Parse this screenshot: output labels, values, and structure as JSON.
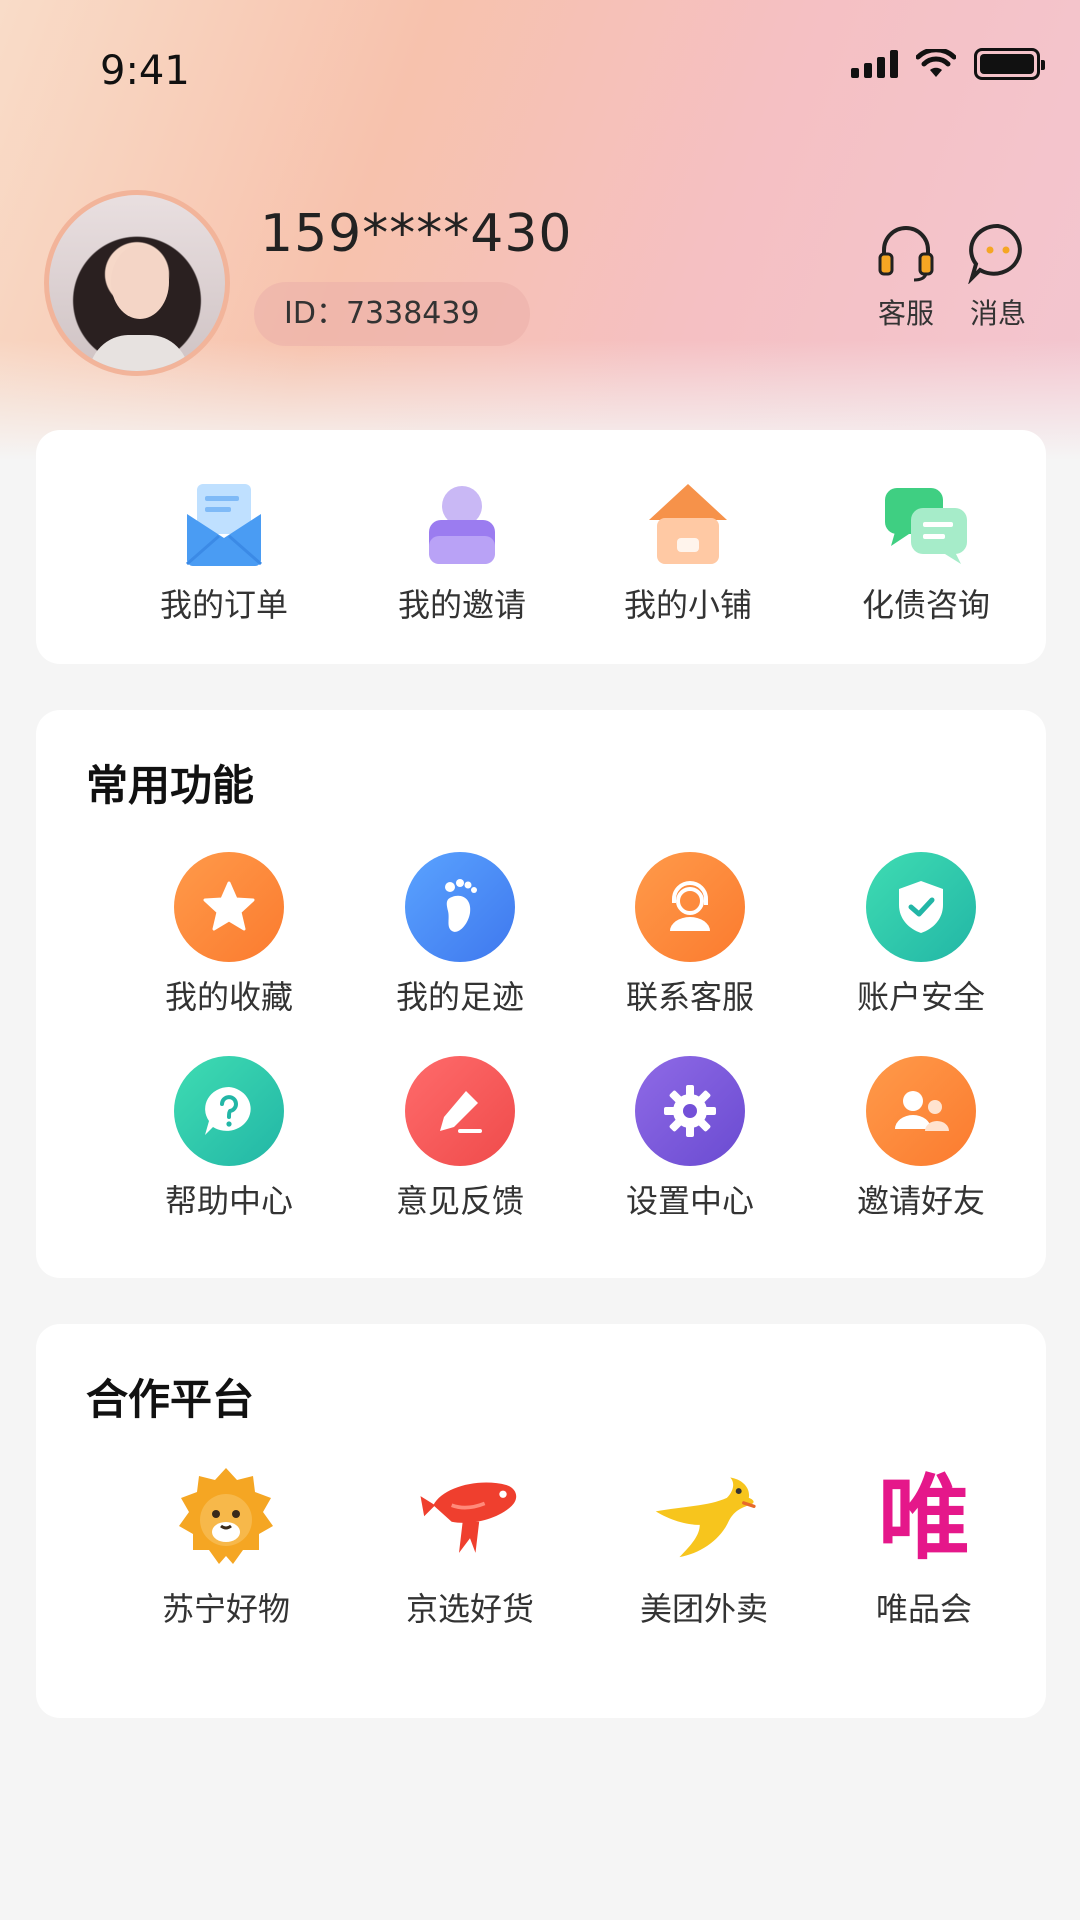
{
  "status_bar": {
    "time": "9:41"
  },
  "profile": {
    "phone": "159****430",
    "id_label": "ID：7338439"
  },
  "top_actions": [
    {
      "label": "客服",
      "icon": "headset-icon"
    },
    {
      "label": "消息",
      "icon": "message-bubble-icon"
    }
  ],
  "quick_entries": [
    {
      "label": "我的订单",
      "icon": "envelope-icon"
    },
    {
      "label": "我的邀请",
      "icon": "user-invite-icon"
    },
    {
      "label": "我的小铺",
      "icon": "shop-house-icon"
    },
    {
      "label": "化债咨询",
      "icon": "chat-consult-icon"
    }
  ],
  "common": {
    "title": "常用功能",
    "items": [
      {
        "label": "我的收藏",
        "icon": "star-icon",
        "color": "#fb8b3c"
      },
      {
        "label": "我的足迹",
        "icon": "footprint-icon",
        "color": "#4f8df5"
      },
      {
        "label": "联系客服",
        "icon": "customer-service-icon",
        "color": "#fb8b3c"
      },
      {
        "label": "账户安全",
        "icon": "shield-check-icon",
        "color": "#2dc5a8"
      },
      {
        "label": "帮助中心",
        "icon": "help-question-icon",
        "color": "#2dc5a8"
      },
      {
        "label": "意见反馈",
        "icon": "pencil-feedback-icon",
        "color": "#f25a5a"
      },
      {
        "label": "设置中心",
        "icon": "gear-icon",
        "color": "#7b5ad6"
      },
      {
        "label": "邀请好友",
        "icon": "invite-friends-icon",
        "color": "#fb8b3c"
      }
    ]
  },
  "partners": {
    "title": "合作平台",
    "items": [
      {
        "label": "苏宁好物",
        "icon": "suning-lion-logo-icon"
      },
      {
        "label": "京选好货",
        "icon": "jd-fish-logo-icon"
      },
      {
        "label": "美团外卖",
        "icon": "meituan-kangaroo-logo-icon"
      },
      {
        "label": "唯品会",
        "icon": "vip-logo-icon",
        "logo_text": "唯"
      }
    ]
  }
}
